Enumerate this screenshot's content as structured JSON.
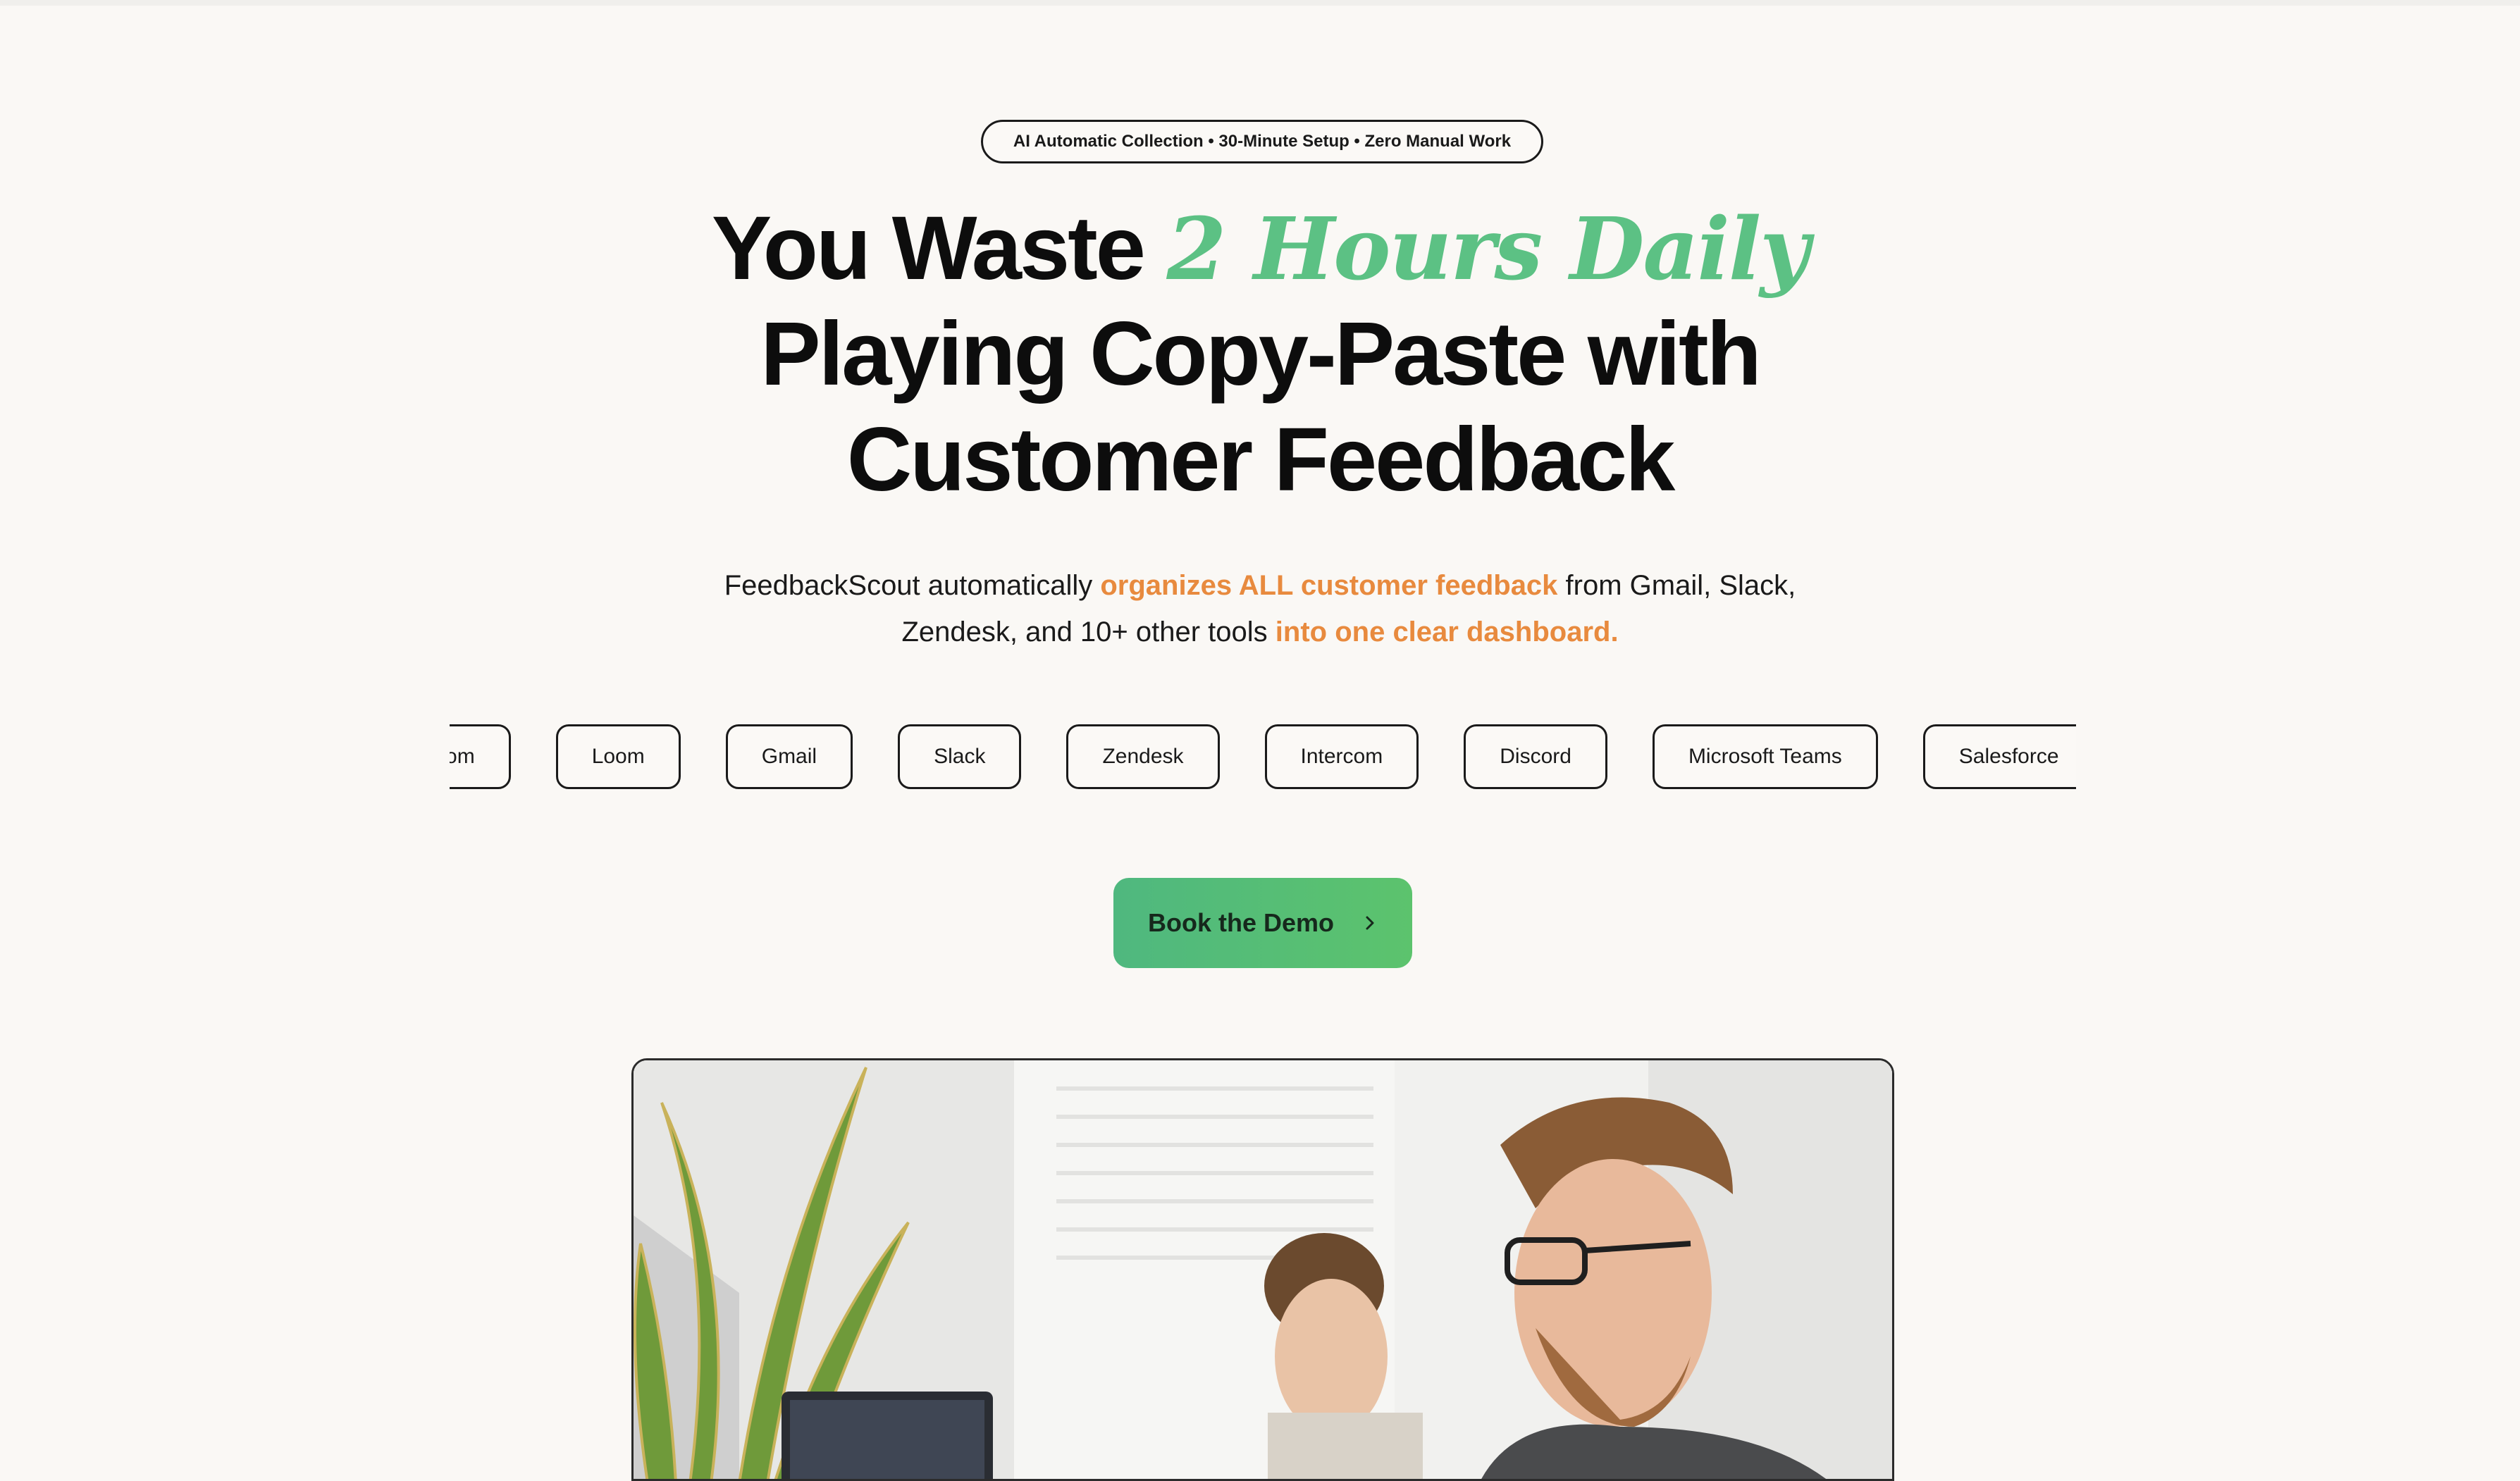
{
  "badge": {
    "text": "AI Automatic Collection • 30-Minute Setup • Zero Manual Work"
  },
  "headline": {
    "line1_plain": "You Waste ",
    "line1_accent": "2 Hours Daily",
    "line2": "Playing Copy-Paste with",
    "line3": "Customer Feedback"
  },
  "subtitle": {
    "part1": "FeedbackScout automatically ",
    "highlight1": "organizes ALL customer feedback",
    "part2": " from Gmail, Slack,",
    "part3": "Zendesk, and 10+ other tools ",
    "highlight2": "into one clear dashboard."
  },
  "tools": [
    "Zoom",
    "Loom",
    "Gmail",
    "Slack",
    "Zendesk",
    "Intercom",
    "Discord",
    "Microsoft Teams",
    "Salesforce"
  ],
  "cta": {
    "label": "Book the Demo",
    "icon": "chevron-right-icon"
  },
  "colors": {
    "accent_green": "#5cc184",
    "highlight_orange": "#e88a3e",
    "background": "#faf8f5",
    "text": "#111111"
  }
}
